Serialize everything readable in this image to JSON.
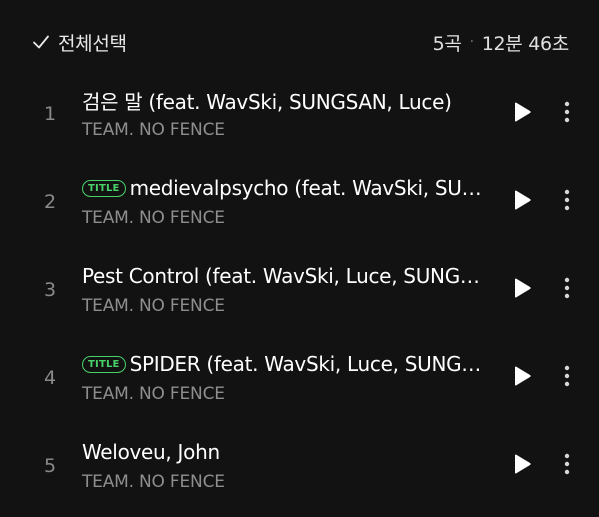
{
  "header": {
    "select_all_label": "전체선택",
    "track_count": "5곡",
    "separator": "·",
    "total_duration": "12분 46초"
  },
  "tracks": [
    {
      "number": "1",
      "title": "검은 말 (feat. WavSki, SUNGSAN, Luce)",
      "badge": "",
      "artist": "TEAM. NO FENCE"
    },
    {
      "number": "2",
      "title": "medievalpsycho (feat. WavSki, SUNGSAN, Luce)",
      "badge": "TITLE",
      "artist": "TEAM. NO FENCE"
    },
    {
      "number": "3",
      "title": "Pest Control (feat. WavSki, Luce, SUNGSAN)",
      "badge": "",
      "artist": "TEAM. NO FENCE"
    },
    {
      "number": "4",
      "title": "SPIDER (feat. WavSki, Luce, SUNGSAN)",
      "badge": "TITLE",
      "artist": "TEAM. NO FENCE"
    },
    {
      "number": "5",
      "title": "Weloveu, John",
      "badge": "",
      "artist": "TEAM. NO FENCE"
    }
  ],
  "icons": {
    "select_all": "check-icon",
    "play": "play-icon",
    "more": "more-vertical-icon"
  },
  "colors": {
    "background": "#121212",
    "title_badge": "#4ad26a",
    "secondary_text": "#8e8e8e"
  }
}
